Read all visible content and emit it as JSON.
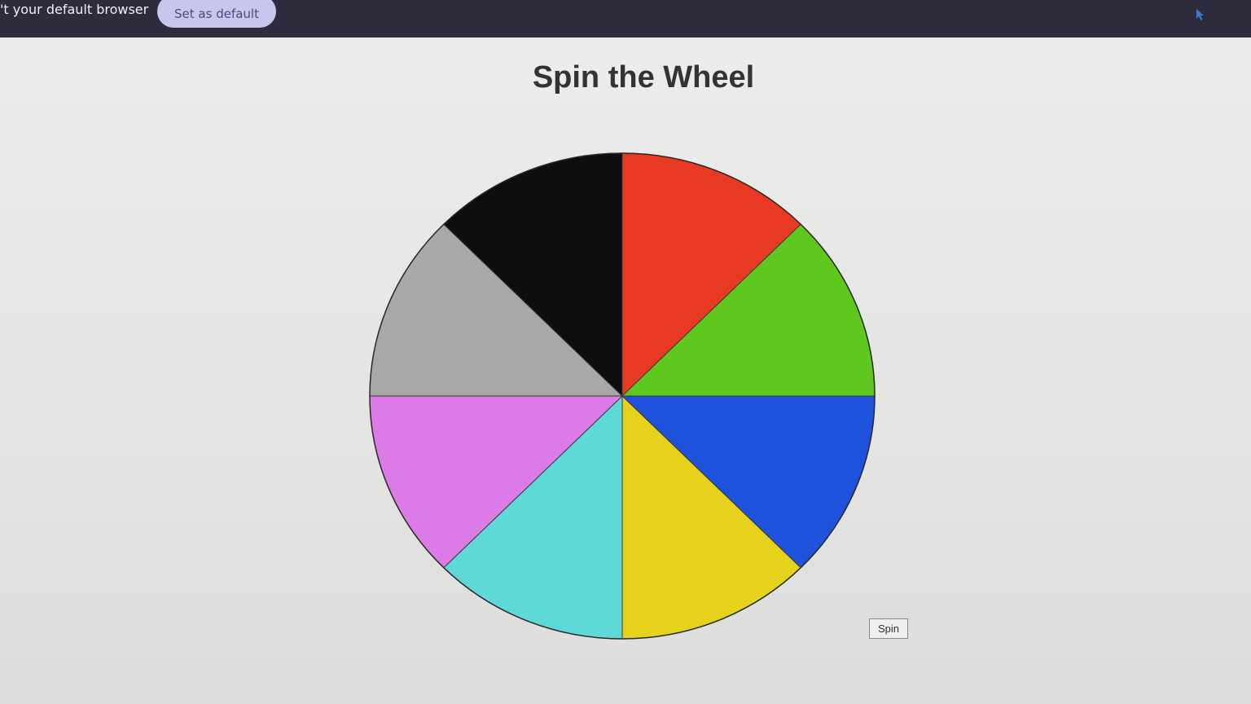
{
  "infobar": {
    "message": "'t your default browser",
    "set_default_label": "Set as default"
  },
  "page": {
    "title": "Spin the Wheel",
    "spin_label": "Spin"
  },
  "wheel": {
    "segments": [
      {
        "color": "#e83a22",
        "label": "red"
      },
      {
        "color": "#5fc81e",
        "label": "green"
      },
      {
        "color": "#1f52dc",
        "label": "blue"
      },
      {
        "color": "#e6d21c",
        "label": "yellow"
      },
      {
        "color": "#5fd8d8",
        "label": "cyan"
      },
      {
        "color": "#dc7ae8",
        "label": "violet"
      },
      {
        "color": "#a8a8a6",
        "label": "gray"
      },
      {
        "color": "#0e0e0e",
        "label": "black"
      }
    ]
  },
  "colors": {
    "infobar_bg": "#2c2c3c",
    "button_bg": "#c9c6ee",
    "cursor": "#3a7bd5"
  }
}
